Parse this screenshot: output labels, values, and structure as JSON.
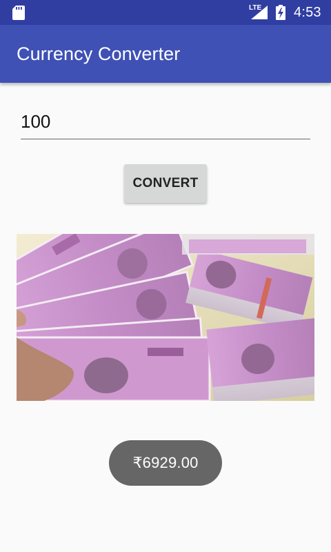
{
  "status_bar": {
    "network": "LTE",
    "time": "4:53",
    "icons": [
      "sd-card-icon",
      "signal-icon",
      "battery-charging-icon"
    ]
  },
  "app_bar": {
    "title": "Currency Converter",
    "color": "#3f51b5"
  },
  "amount_input": {
    "value": "100"
  },
  "convert_button": {
    "label": "CONVERT"
  },
  "image": {
    "subject": "Indian 2000 rupee banknotes"
  },
  "toast": {
    "message": "₹6929.00"
  },
  "colors": {
    "status_bar": "#2f3ea0",
    "primary": "#3f51b5",
    "button": "#d6d7d7",
    "toast": "#666666",
    "banknote": "#c58ec8"
  }
}
